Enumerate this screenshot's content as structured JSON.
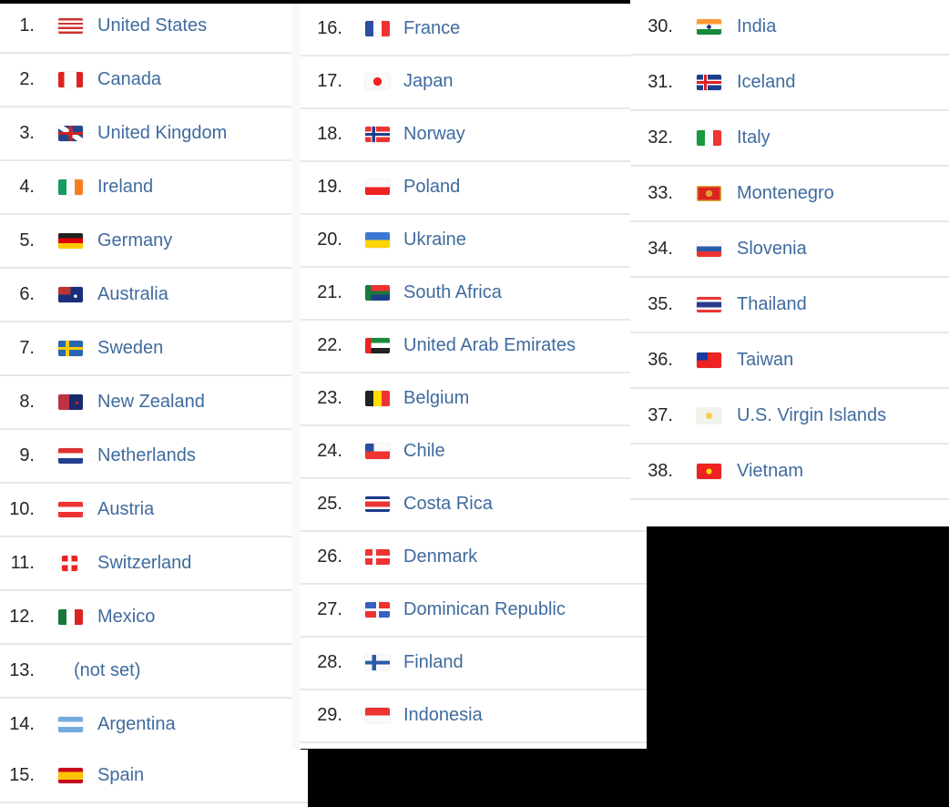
{
  "countries": [
    {
      "rank": "1.",
      "name": "United States",
      "flag": "us-flag-icon"
    },
    {
      "rank": "2.",
      "name": "Canada",
      "flag": "ca-flag-icon"
    },
    {
      "rank": "3.",
      "name": "United Kingdom",
      "flag": "gb-flag-icon"
    },
    {
      "rank": "4.",
      "name": "Ireland",
      "flag": "ie-flag-icon"
    },
    {
      "rank": "5.",
      "name": "Germany",
      "flag": "de-flag-icon"
    },
    {
      "rank": "6.",
      "name": "Australia",
      "flag": "au-flag-icon"
    },
    {
      "rank": "7.",
      "name": "Sweden",
      "flag": "se-flag-icon"
    },
    {
      "rank": "8.",
      "name": "New Zealand",
      "flag": "nz-flag-icon"
    },
    {
      "rank": "9.",
      "name": "Netherlands",
      "flag": "nl-flag-icon"
    },
    {
      "rank": "10.",
      "name": "Austria",
      "flag": "at-flag-icon"
    },
    {
      "rank": "11.",
      "name": "Switzerland",
      "flag": "ch-flag-icon"
    },
    {
      "rank": "12.",
      "name": "Mexico",
      "flag": "mx-flag-icon"
    },
    {
      "rank": "13.",
      "name": "(not set)",
      "flag": ""
    },
    {
      "rank": "14.",
      "name": "Argentina",
      "flag": "ar-flag-icon"
    },
    {
      "rank": "15.",
      "name": "Spain",
      "flag": "es-flag-icon"
    },
    {
      "rank": "16.",
      "name": "France",
      "flag": "fr-flag-icon"
    },
    {
      "rank": "17.",
      "name": "Japan",
      "flag": "jp-flag-icon"
    },
    {
      "rank": "18.",
      "name": "Norway",
      "flag": "no-flag-icon"
    },
    {
      "rank": "19.",
      "name": "Poland",
      "flag": "pl-flag-icon"
    },
    {
      "rank": "20.",
      "name": "Ukraine",
      "flag": "ua-flag-icon"
    },
    {
      "rank": "21.",
      "name": "South Africa",
      "flag": "za-flag-icon"
    },
    {
      "rank": "22.",
      "name": "United Arab Emirates",
      "flag": "ae-flag-icon"
    },
    {
      "rank": "23.",
      "name": "Belgium",
      "flag": "be-flag-icon"
    },
    {
      "rank": "24.",
      "name": "Chile",
      "flag": "cl-flag-icon"
    },
    {
      "rank": "25.",
      "name": "Costa Rica",
      "flag": "cr-flag-icon"
    },
    {
      "rank": "26.",
      "name": "Denmark",
      "flag": "dk-flag-icon"
    },
    {
      "rank": "27.",
      "name": "Dominican Republic",
      "flag": "do-flag-icon"
    },
    {
      "rank": "28.",
      "name": "Finland",
      "flag": "fi-flag-icon"
    },
    {
      "rank": "29.",
      "name": "Indonesia",
      "flag": "id-flag-icon"
    },
    {
      "rank": "30.",
      "name": "India",
      "flag": "in-flag-icon"
    },
    {
      "rank": "31.",
      "name": "Iceland",
      "flag": "is-flag-icon"
    },
    {
      "rank": "32.",
      "name": "Italy",
      "flag": "it-flag-icon"
    },
    {
      "rank": "33.",
      "name": "Montenegro",
      "flag": "me-flag-icon"
    },
    {
      "rank": "34.",
      "name": "Slovenia",
      "flag": "si-flag-icon"
    },
    {
      "rank": "35.",
      "name": "Thailand",
      "flag": "th-flag-icon"
    },
    {
      "rank": "36.",
      "name": "Taiwan",
      "flag": "tw-flag-icon"
    },
    {
      "rank": "37.",
      "name": "U.S. Virgin Islands",
      "flag": "vi-flag-icon"
    },
    {
      "rank": "38.",
      "name": "Vietnam",
      "flag": "vn-flag-icon"
    }
  ],
  "colors": {
    "link": "#3f6b9e",
    "rank": "#262626",
    "divider": "#e6e8eb",
    "background": "#000000"
  }
}
